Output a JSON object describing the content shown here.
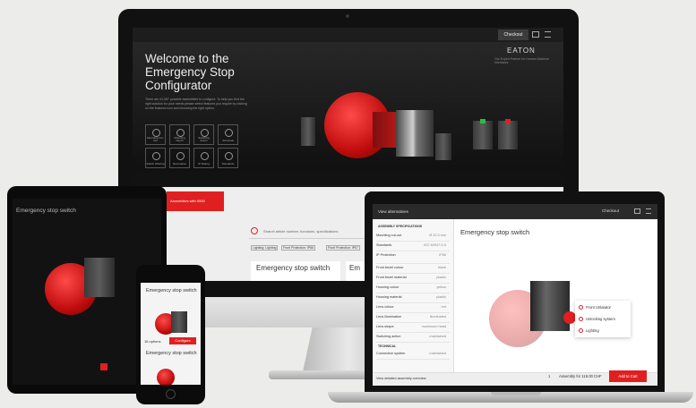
{
  "imac": {
    "checkout": "Checkout",
    "brand": "EATON",
    "brand_tag": "Our Expert Partner for Human Machine Interfaces",
    "title_line1": "Welcome to the",
    "title_line2": "Emergency Stop",
    "title_line3": "Configurator",
    "intro": "There are 61,067 possible assemblies to configure. To help you find the right solution for your needs please select features you require by clicking on the features icon and choosing the right option.",
    "features": [
      {
        "label": "Mounting Cut-Out",
        "icon": "circle-slash-icon"
      },
      {
        "label": "Mounting Depth",
        "icon": "depth-icon"
      },
      {
        "label": "Switching Action",
        "icon": "shuffle-icon"
      },
      {
        "label": "Terminals",
        "icon": "pin-icon"
      },
      {
        "label": "Switch Offering",
        "icon": "bolt-icon"
      },
      {
        "label": "Illumination",
        "icon": "sun-icon"
      },
      {
        "label": "IP Rating",
        "icon": "drop-icon"
      },
      {
        "label": "Standards",
        "icon": "doc-icon"
      }
    ],
    "banner": "Assemblies with 0000",
    "search_placeholder": "Search article number, functions, specifications",
    "filters": [
      "Lighting: Lighting",
      "Front Protection: IP66",
      "Front Protection: IP67"
    ],
    "card1": "Emergency stop switch",
    "card2": "Em"
  },
  "tablet": {
    "title": "Emergency stop switch"
  },
  "phone": {
    "title": "Emergency stop switch",
    "options": "16 options",
    "configure": "Configure",
    "title2": "Emergency stop switch"
  },
  "laptop": {
    "view_alternatives": "View alternatives",
    "checkout": "Checkout",
    "heading": "Emergency stop switch",
    "section": "ASSEMBLY SPECIFICATIONS",
    "rows": [
      {
        "k": "Mounting cut-out",
        "v": "Ø 22.3 mm"
      },
      {
        "k": "Standards",
        "v": "IEC 60947-5-5"
      },
      {
        "k": "IP Protection",
        "v": "IP66"
      },
      {
        "k": "Front bezel colour",
        "v": "black"
      },
      {
        "k": "Front bezel material",
        "v": "plastic"
      },
      {
        "k": "Housing colour",
        "v": "yellow"
      },
      {
        "k": "Housing material",
        "v": "plastic"
      },
      {
        "k": "Lens colour",
        "v": "red"
      },
      {
        "k": "Lens illumination",
        "v": "illuminated"
      },
      {
        "k": "Lens shape",
        "v": "mushroom head"
      },
      {
        "k": "Switching action",
        "v": "maintained"
      }
    ],
    "technical": "TECHNICAL",
    "connection": "Connection system",
    "connection_val": "maintained",
    "popup": [
      "Front Unlatator",
      "Unlocking system",
      "Lighting"
    ],
    "footer_left": "View detailed assembly overview",
    "assembly_price": "Assembly for 119.00 CHF",
    "add_to_cart": "Add to Cart",
    "qty": "1"
  }
}
